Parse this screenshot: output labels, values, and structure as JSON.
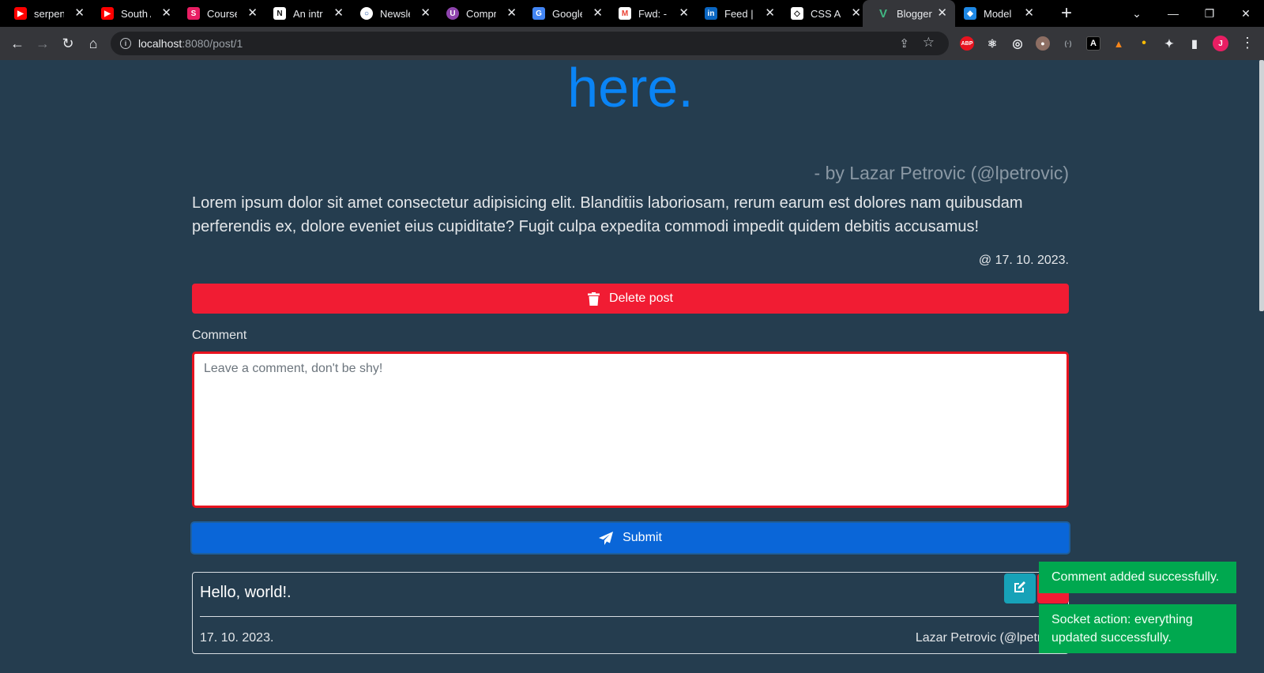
{
  "browser": {
    "tabs": [
      {
        "title": "serpent",
        "favicon": "youtube-icon",
        "color": "#ff0000"
      },
      {
        "title": "South A",
        "favicon": "youtube-icon",
        "color": "#ff0000"
      },
      {
        "title": "Course",
        "favicon": "course-icon",
        "color": "#e91e63"
      },
      {
        "title": "An intro",
        "favicon": "article-icon",
        "color": "#ffffff"
      },
      {
        "title": "Newslet",
        "favicon": "newsletter-icon",
        "color": "#ffffff"
      },
      {
        "title": "Compre",
        "favicon": "compress-icon",
        "color": "#8e44ad"
      },
      {
        "title": "Google",
        "favicon": "google-translate-icon",
        "color": "#4285f4"
      },
      {
        "title": "Fwd: - p",
        "favicon": "gmail-icon",
        "color": "#ea4335"
      },
      {
        "title": "Feed | L",
        "favicon": "linkedin-icon",
        "color": "#0a66c2"
      },
      {
        "title": "CSS Ani",
        "favicon": "codepen-icon",
        "color": "#ffffff"
      },
      {
        "title": "Blogger",
        "favicon": "vue-icon",
        "color": "#41b883",
        "active": true
      },
      {
        "title": "Model C",
        "favicon": "cube-icon",
        "color": "#1e88e5"
      }
    ],
    "url_host": "localhost",
    "url_rest": ":8080/post/1",
    "profile_initial": "J",
    "extensions": [
      {
        "name": "adblock-icon",
        "label": "ABP",
        "color": "#e8131f"
      },
      {
        "name": "react-devtools-icon",
        "label": "⚛",
        "color": "#35363a"
      },
      {
        "name": "target-icon",
        "label": "◎",
        "color": "#35363a"
      },
      {
        "name": "owl-icon",
        "label": "●",
        "color": "#8d6e63"
      },
      {
        "name": "bracket-icon",
        "label": "(·)",
        "color": "#35363a"
      },
      {
        "name": "font-icon",
        "label": "A",
        "color": "#000000"
      },
      {
        "name": "metamask-icon",
        "label": "▲",
        "color": "#f6851b"
      },
      {
        "name": "dots-extension-icon",
        "label": "•",
        "color": "#35363a"
      },
      {
        "name": "puzzle-icon",
        "label": "✦",
        "color": "#35363a"
      },
      {
        "name": "sidepanel-icon",
        "label": "▮",
        "color": "#35363a"
      }
    ]
  },
  "post": {
    "title": "Some custom title text inserted here.",
    "byline": "- by Lazar Petrovic (@lpetrovic)",
    "body": "Lorem ipsum dolor sit amet consectetur adipisicing elit. Blanditiis laboriosam, rerum earum est dolores nam quibusdam perferendis ex, dolore eveniet eius cupiditate? Fugit culpa expedita commodi impedit quidem debitis accusamus!",
    "date": "@ 17. 10. 2023.",
    "delete_label": "Delete post"
  },
  "comment_form": {
    "label": "Comment",
    "placeholder": "Leave a comment, don't be shy!",
    "submit_label": "Submit"
  },
  "comments": [
    {
      "text": "Hello, world!.",
      "date": "17. 10. 2023.",
      "author": "Lazar Petrovic (@lpetrovic)"
    }
  ],
  "toasts": [
    {
      "message": "Comment added successfully."
    },
    {
      "message": "Socket action: everything updated successfully."
    }
  ],
  "colors": {
    "accent": "#0a84f5",
    "danger": "#f11c33",
    "primary": "#0a66d8",
    "success": "#00a84f",
    "info": "#17a2b8",
    "page_bg": "#253d4f"
  }
}
